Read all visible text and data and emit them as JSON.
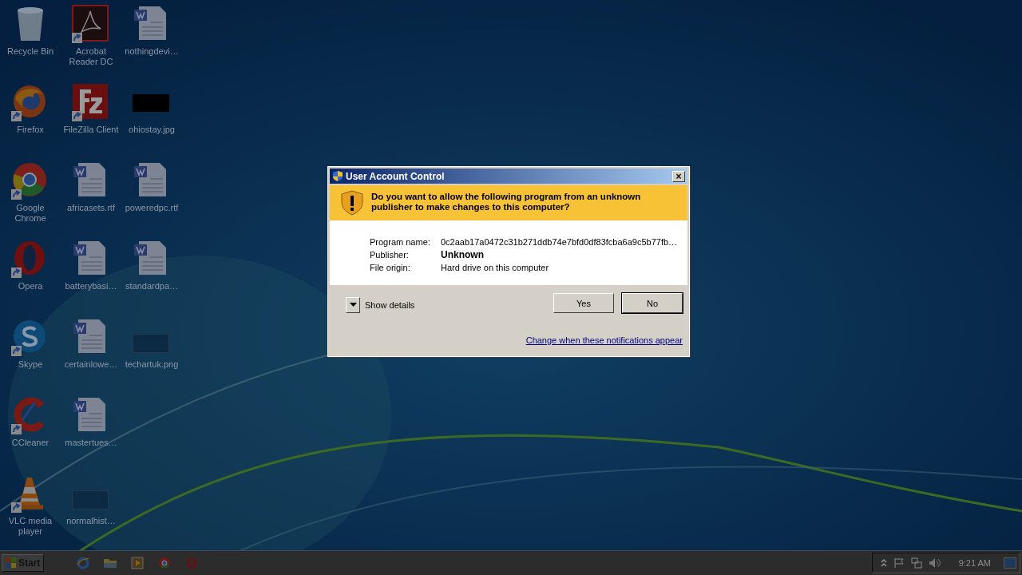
{
  "desktop": {
    "icons": [
      {
        "label": "Recycle Bin",
        "kind": "recycle",
        "shortcut": false
      },
      {
        "label": "Firefox",
        "kind": "firefox",
        "shortcut": true
      },
      {
        "label": "Google Chrome",
        "kind": "chrome",
        "shortcut": true
      },
      {
        "label": "Opera",
        "kind": "opera",
        "shortcut": true
      },
      {
        "label": "Skype",
        "kind": "skype",
        "shortcut": true
      },
      {
        "label": "CCleaner",
        "kind": "ccleaner",
        "shortcut": true
      },
      {
        "label": "VLC media player",
        "kind": "vlc",
        "shortcut": true
      },
      {
        "label": "Acrobat Reader DC",
        "kind": "acrobat",
        "shortcut": true
      },
      {
        "label": "FileZilla Client",
        "kind": "filezilla",
        "shortcut": true
      },
      {
        "label": "africasets.rtf",
        "kind": "word",
        "shortcut": false
      },
      {
        "label": "batterybasi…",
        "kind": "word",
        "shortcut": false
      },
      {
        "label": "certainlowe…",
        "kind": "word",
        "shortcut": false
      },
      {
        "label": "mastertues…",
        "kind": "word",
        "shortcut": false
      },
      {
        "label": "normalhist…",
        "kind": "blank",
        "shortcut": false
      },
      {
        "label": "nothingdevi…",
        "kind": "word",
        "shortcut": false
      },
      {
        "label": "ohiostay.jpg",
        "kind": "black",
        "shortcut": false
      },
      {
        "label": "poweredpc.rtf",
        "kind": "word",
        "shortcut": false
      },
      {
        "label": "standardpa…",
        "kind": "word",
        "shortcut": false
      },
      {
        "label": "techartuk.png",
        "kind": "blank",
        "shortcut": false
      }
    ]
  },
  "dialog": {
    "title": "User Account Control",
    "close": "×",
    "question": "Do you want to allow the following program from an unknown publisher to make changes to this computer?",
    "fields": [
      {
        "label": "Program name:",
        "value": "0c2aab17a0472c31b271ddb74e7bfd0df83fcba6a9c5b77fb…",
        "bold": false
      },
      {
        "label": "Publisher:",
        "value": "Unknown",
        "bold": true
      },
      {
        "label": "File origin:",
        "value": "Hard drive on this computer",
        "bold": false
      }
    ],
    "details": {
      "label": "Show details",
      "expanded": false
    },
    "buttons": [
      {
        "label": "Yes",
        "selected": false
      },
      {
        "label": "No",
        "selected": true
      }
    ],
    "link": "Change when these notifications appear"
  },
  "taskbar": {
    "start": "Start",
    "apps": [
      {
        "kind": "ie"
      },
      {
        "kind": "folder"
      },
      {
        "kind": "media"
      },
      {
        "kind": "chrome"
      },
      {
        "kind": "opera"
      }
    ],
    "clock": "9:21 AM"
  }
}
